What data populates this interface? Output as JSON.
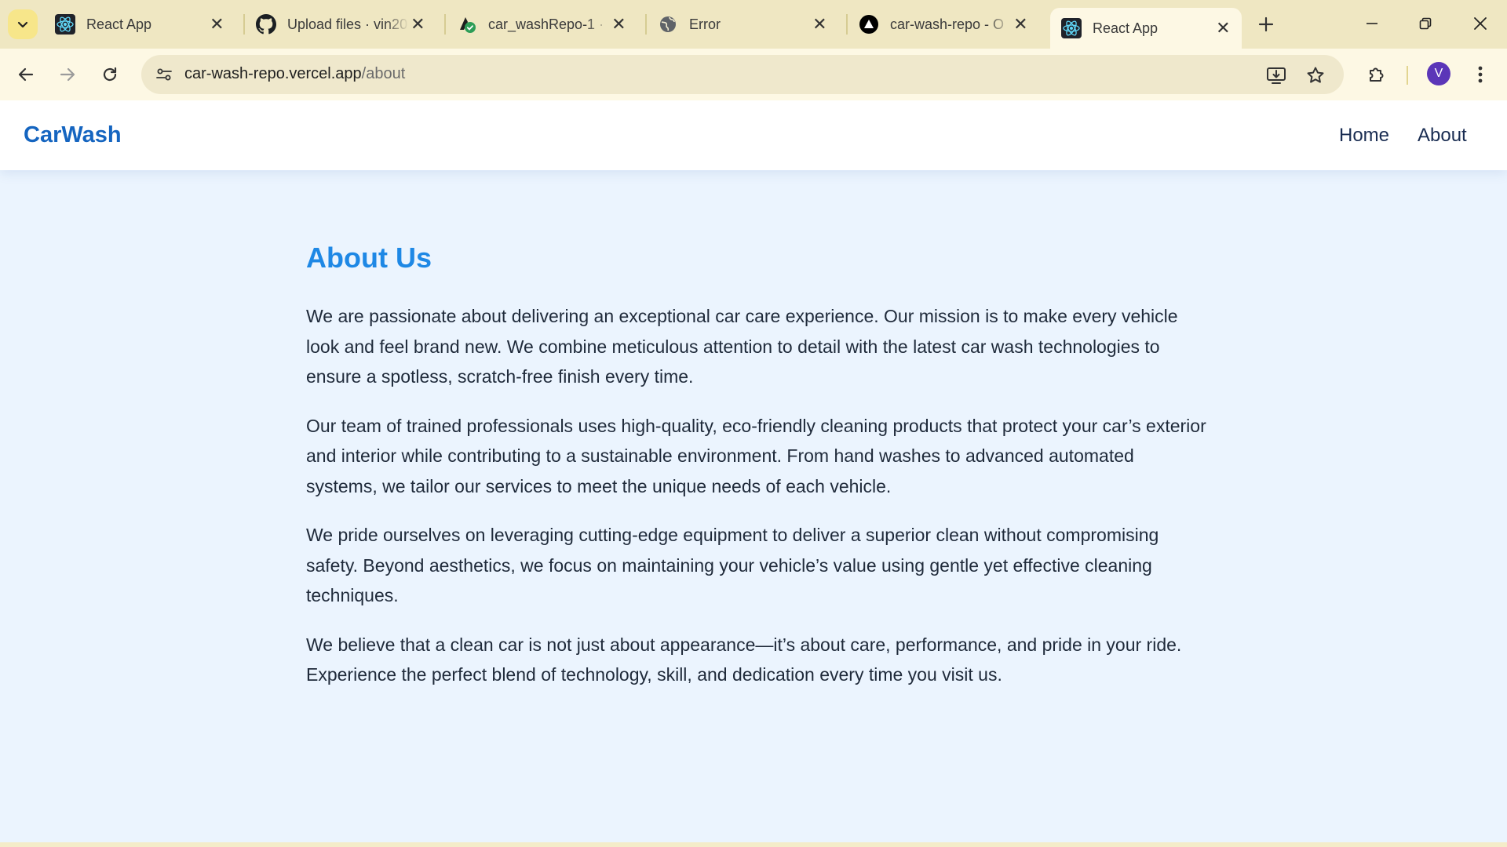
{
  "browser": {
    "tabs": [
      {
        "title": "React App",
        "icon": "react-icon",
        "active": false
      },
      {
        "title": "Upload files · vin20",
        "icon": "github-icon",
        "active": false
      },
      {
        "title": "car_washRepo-1 · ",
        "icon": "deploy-check-icon",
        "active": false
      },
      {
        "title": "Error",
        "icon": "globe-icon",
        "active": false
      },
      {
        "title": "car-wash-repo - O",
        "icon": "vercel-icon",
        "active": false
      },
      {
        "title": "React App",
        "icon": "react-icon",
        "active": true
      }
    ],
    "address": {
      "host": "car-wash-repo.vercel.app",
      "path": "/about"
    },
    "profile_initial": "V",
    "accent": "#5b36b8"
  },
  "site": {
    "brand": "CarWash",
    "nav": [
      "Home",
      "About"
    ],
    "colors": {
      "brand": "#1565c0",
      "heading": "#1e88e5",
      "background": "#ebf4fe"
    }
  },
  "about": {
    "heading": "About Us",
    "paragraphs": [
      "We are passionate about delivering an exceptional car care experience. Our mission is to make every vehicle look and feel brand new. We combine meticulous attention to detail with the latest car wash technologies to ensure a spotless, scratch-free finish every time.",
      "Our team of trained professionals uses high-quality, eco-friendly cleaning products that protect your car’s exterior and interior while contributing to a sustainable environment. From hand washes to advanced automated systems, we tailor our services to meet the unique needs of each vehicle.",
      "We pride ourselves on leveraging cutting-edge equipment to deliver a superior clean without compromising safety. Beyond aesthetics, we focus on maintaining your vehicle’s value using gentle yet effective cleaning techniques.",
      "We believe that a clean car is not just about appearance—it’s about care, performance, and pride in your ride. Experience the perfect blend of technology, skill, and dedication every time you visit us."
    ]
  }
}
